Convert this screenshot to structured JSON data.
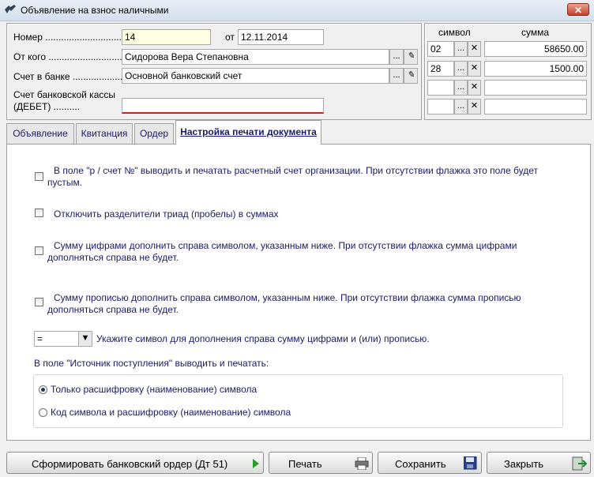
{
  "window": {
    "title": "Объявление на взнос наличными",
    "close": "✕"
  },
  "header": {
    "nomer_label": "Номер ..............................",
    "nomer_value": "14",
    "ot_label": "от",
    "date_value": "12.11.2014",
    "from_label": "От кого ...............................",
    "from_value": "Сидорова Вера Степановна",
    "bank_label": "Счет в банке ...................",
    "bank_value": "Основной банковский счет",
    "cash_label_1": "Счет банковской кассы",
    "cash_label_2": "(ДЕБЕТ) ..........",
    "cash_value": "",
    "dots": "...",
    "x": "✕"
  },
  "symbols": {
    "col_symbol": "символ",
    "col_sum": "сумма",
    "rows": [
      {
        "symbol": "02",
        "sum": "58650.00"
      },
      {
        "symbol": "28",
        "sum": "1500.00"
      },
      {
        "symbol": "",
        "sum": ""
      },
      {
        "symbol": "",
        "sum": ""
      }
    ]
  },
  "tabs": [
    "Объявление",
    "Квитанция",
    "Ордер",
    "Настройка печати документа"
  ],
  "options": {
    "opt1_l1": "В поле \"р / счет №\" выводить и печатать расчетный счет организации. При отсутствии флажка это поле будет",
    "opt1_l2": "пустым.",
    "opt2": "Отключить разделители триад (пробелы) в суммах",
    "opt3_l1": "Сумму цифрами дополнить справа символом, указанным ниже. При отсутствии флажка сумма цифрами",
    "opt3_l2": "дополняться справа не будет.",
    "opt4_l1": "Сумму прописью дополнить справа символом, указанным ниже. При отсутствии флажка сумма прописью",
    "opt4_l2": "дополняться справа не будет.",
    "symbol_value": "=",
    "symbol_hint": "Укажите символ для дополнения справа сумму цифрами и (или) прописью.",
    "source_label": "В поле \"Источник поступления\" выводить и печатать:",
    "radio1": "Только расшифровку (наименование) символа",
    "radio2": "Код символа и расшифровку (наименование) символа"
  },
  "buttons": {
    "order": "Сформировать банковский ордер (Дт 51)",
    "print": "Печать",
    "save": "Сохранить",
    "close": "Закрыть"
  }
}
